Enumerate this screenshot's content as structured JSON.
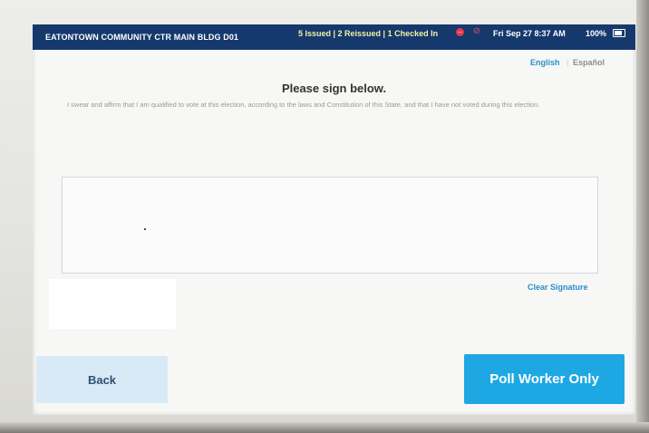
{
  "status_bar": {
    "location": "EATONTOWN COMMUNITY CTR MAIN BLDG D01",
    "counts": "5 Issued | 2 Reissued | 1 Checked In",
    "datetime": "Fri Sep 27  8:37 AM",
    "battery": "100%",
    "icons": [
      "alert-icon",
      "no-connection-icon",
      "battery-icon"
    ],
    "background_color": "#15396d"
  },
  "language": {
    "english": "English",
    "separator": "|",
    "spanish": "Español"
  },
  "main": {
    "title": "Please sign below.",
    "oath": "I swear and affirm that I am qualified to vote at this election, according to the laws and Constitution of this State, and that I have not voted during this election."
  },
  "signature": {
    "clear_label": "Clear Signature"
  },
  "buttons": {
    "back": "Back",
    "poll_worker": "Poll Worker Only",
    "primary_color": "#1ea8e3",
    "secondary_color": "#d8eaf6"
  }
}
